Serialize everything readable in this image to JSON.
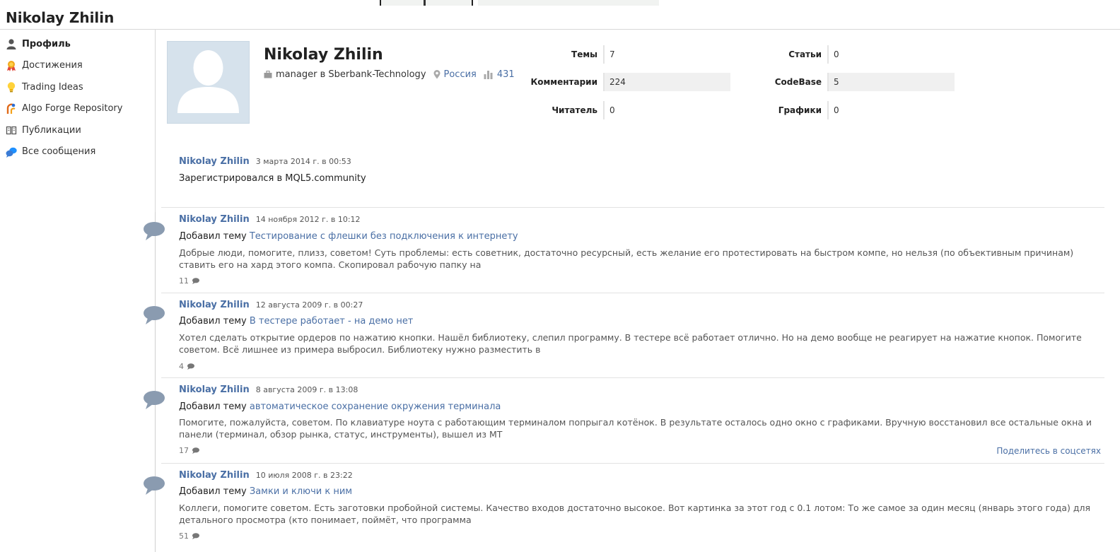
{
  "page": {
    "title": "Nikolay Zhilin"
  },
  "sidebar": {
    "items": [
      {
        "label": "Профиль",
        "icon": "person-icon",
        "active": true
      },
      {
        "label": "Достижения",
        "icon": "medal-icon"
      },
      {
        "label": "Trading Ideas",
        "icon": "lightbulb-icon"
      },
      {
        "label": "Algo Forge Repository",
        "icon": "forge-icon"
      },
      {
        "label": "Публикации",
        "icon": "book-icon"
      },
      {
        "label": "Все сообщения",
        "icon": "chat-bubbles-icon"
      }
    ]
  },
  "profile": {
    "name": "Nikolay Zhilin",
    "job": "manager в Sberbank-Technology",
    "country": "Россия",
    "rating": "431",
    "stats": {
      "topics_label": "Темы",
      "topics": "7",
      "comments_label": "Комментарии",
      "comments": "224",
      "readers_label": "Читатель",
      "readers": "0",
      "articles_label": "Статьи",
      "articles": "0",
      "codebase_label": "CodeBase",
      "codebase": "5",
      "charts_label": "Графики",
      "charts": "0"
    }
  },
  "feed": {
    "registration": {
      "author": "Nikolay Zhilin",
      "date": "3 марта 2014 г. в 00:53",
      "text": "Зарегистрировался в MQL5.community"
    },
    "share_label": "Поделитесь в соцсетях",
    "posts": [
      {
        "author": "Nikolay Zhilin",
        "date": "14 ноября 2012 г. в 10:12",
        "action": "Добавил тему",
        "topic": "Тестирование с флешки без подключения к интернету",
        "excerpt": "Добрые люди, помогите, плизз, советом! Суть проблемы: есть советник, достаточно ресурсный, есть желание его протестировать на быстром компе, но нельзя (по объективным причинам) ставить его на хард этого компа. Скопировал рабочую папку на",
        "comments": "11"
      },
      {
        "author": "Nikolay Zhilin",
        "date": "12 августа 2009 г. в 00:27",
        "action": "Добавил тему",
        "topic": "В тестере работает - на демо нет",
        "excerpt": "Хотел сделать открытие ордеров по нажатию кнопки. Нашёл библиотеку, слепил программу. В тестере всё работает отлично. Но на демо вообще не реагирует на нажатие кнопок. Помогите советом. Всё лишнее из примера выбросил. Библиотеку нужно разместить в",
        "comments": "4"
      },
      {
        "author": "Nikolay Zhilin",
        "date": "8 августа 2009 г. в 13:08",
        "action": "Добавил тему",
        "topic": "автоматическое сохранение окружения терминала",
        "excerpt": "Помогите, пожалуйста, советом. По клавиатуре ноута с работающим терминалом попрыгал котёнок. В результате осталось одно окно с графиками. Вручную восстановил все остальные окна и панели (терминал, обзор рынка, статус, инструменты), вышел из МТ",
        "comments": "17"
      },
      {
        "author": "Nikolay Zhilin",
        "date": "10 июля 2008 г. в 23:22",
        "action": "Добавил тему",
        "topic": "Замки и ключи к ним",
        "excerpt": "Коллеги, помогите советом. Есть заготовки пробойной системы. Качество входов достаточно высокое. Вот картинка за этот год с 0.1 лотом: То же самое за один месяц (январь этого года) для детального просмотра (кто понимает, поймёт, что программа",
        "comments": "51"
      }
    ]
  }
}
